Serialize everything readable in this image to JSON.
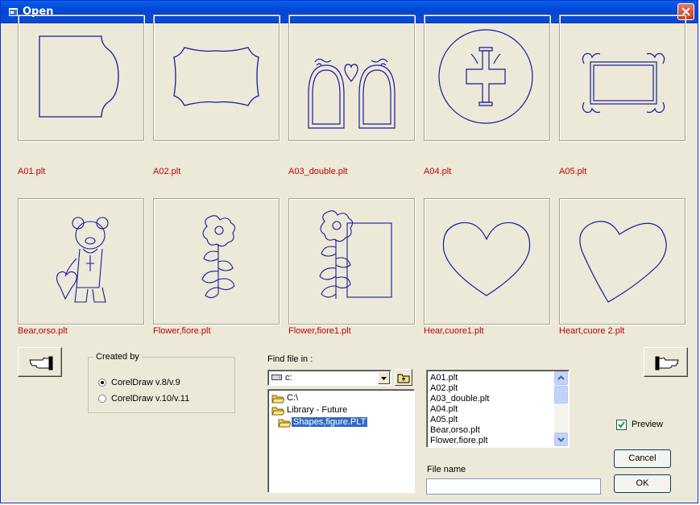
{
  "window": {
    "title": "Open"
  },
  "tiles": [
    {
      "label": "A01.plt",
      "icon": "a01-shape-thumbnail"
    },
    {
      "label": "A02.plt",
      "icon": "a02-shape-thumbnail"
    },
    {
      "label": "A03_double.plt",
      "icon": "a03-double-arch-thumbnail"
    },
    {
      "label": "A04.plt",
      "icon": "a04-cross-circle-thumbnail"
    },
    {
      "label": "A05.plt",
      "icon": "a05-frame-thumbnail"
    },
    {
      "label": "Bear,orso.plt",
      "icon": "bear-thumbnail"
    },
    {
      "label": "Flower,fiore.plt",
      "icon": "flower-thumbnail"
    },
    {
      "label": "Flower,fiore1.plt",
      "icon": "flower-frame-thumbnail"
    },
    {
      "label": "Hear,cuore1.plt",
      "icon": "heart-thumbnail"
    },
    {
      "label": "Heart,cuore 2.plt",
      "icon": "heart-tilted-thumbnail"
    }
  ],
  "created_by": {
    "legend": "Created by",
    "options": [
      "CorelDraw v.8/v.9",
      "CorelDraw v.10/v.11"
    ],
    "selected": 0
  },
  "find": {
    "label": "Find file in :",
    "drive": "c:",
    "folders": [
      {
        "name": "C:\\",
        "selected": false
      },
      {
        "name": "Library - Future",
        "selected": false
      },
      {
        "name": "Shapes,figure.PLT",
        "selected": true
      }
    ]
  },
  "files": [
    "A01.plt",
    "A02.plt",
    "A03_double.plt",
    "A04.plt",
    "A05.plt",
    "Bear,orso.plt",
    "Flower,fiore.plt"
  ],
  "file_name": {
    "label": "File name",
    "value": ""
  },
  "preview": {
    "label": "Preview",
    "checked": true
  },
  "buttons": {
    "cancel": "Cancel",
    "ok": "OK"
  },
  "colors": {
    "thumbnail_stroke": "#1a1a9c",
    "label_red": "#c00000",
    "selection": "#316ac5"
  }
}
